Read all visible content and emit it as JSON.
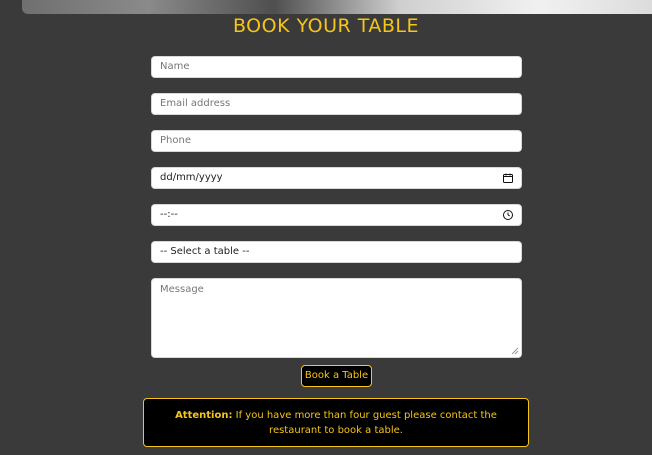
{
  "header": {
    "title": "BOOK YOUR TABLE"
  },
  "form": {
    "name_placeholder": "Name",
    "email_placeholder": "Email address",
    "phone_placeholder": "Phone",
    "date_value": "dd/mm/yyyy",
    "time_value": "--:--",
    "table_select_value": "-- Select a table --",
    "message_placeholder": "Message",
    "submit_label": "Book a Table"
  },
  "notice": {
    "label": "Attention:",
    "text": " If you have more than four guest please contact the restaurant to book a table."
  },
  "colors": {
    "accent": "#f5c518",
    "background": "#3a3a3a",
    "notice_background": "#000000"
  },
  "icons": {
    "date": "calendar-icon",
    "time": "clock-icon",
    "resize": "resize-handle-icon"
  }
}
